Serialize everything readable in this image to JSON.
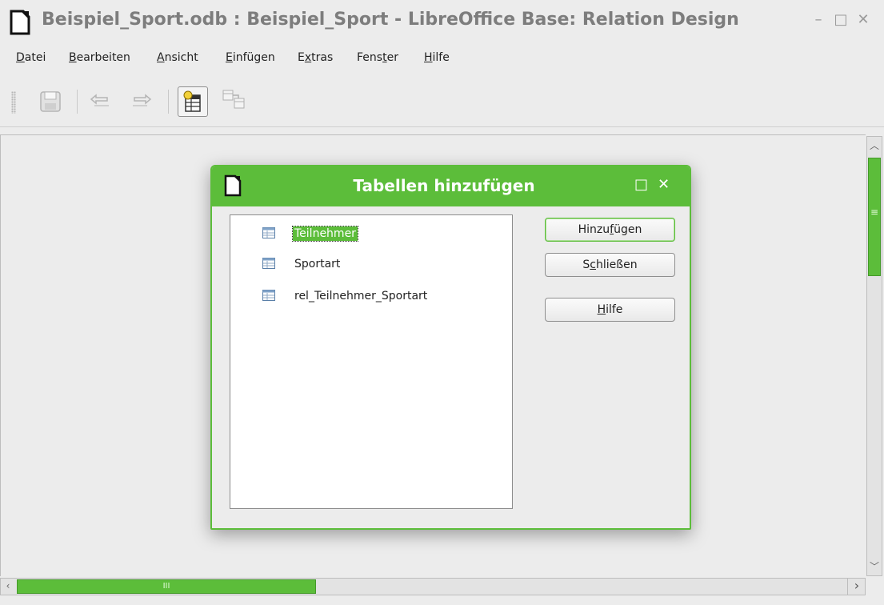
{
  "window": {
    "title": "Beispiel_Sport.odb : Beispiel_Sport - LibreOffice Base: Relation Design",
    "minimize": "–",
    "maximize": "□",
    "close": "✕"
  },
  "menubar": {
    "items": [
      {
        "mnemonic": "D",
        "rest": "atei"
      },
      {
        "mnemonic": "B",
        "rest": "earbeiten"
      },
      {
        "mnemonic": "A",
        "rest": "nsicht"
      },
      {
        "mnemonic": "E",
        "rest": "infügen"
      },
      {
        "pre": "E",
        "mnemonic": "x",
        "rest": "tras"
      },
      {
        "pre": "Fens",
        "mnemonic": "t",
        "rest": "er"
      },
      {
        "mnemonic": "H",
        "rest": "ilfe"
      }
    ]
  },
  "toolbar": {
    "icons": [
      "save-icon",
      "undo-icon",
      "redo-icon",
      "add-tables-icon",
      "new-relation-icon"
    ]
  },
  "dialog": {
    "title": "Tabellen hinzufügen",
    "maximize": "□",
    "close": "✕",
    "tables": [
      {
        "name": "Teilnehmer",
        "selected": true
      },
      {
        "name": "Sportart",
        "selected": false
      },
      {
        "name": "rel_Teilnehmer_Sportart",
        "selected": false
      }
    ],
    "buttons": {
      "add": {
        "pre": "Hinzu",
        "mnemonic": "f",
        "rest": "ügen"
      },
      "close": {
        "pre": "S",
        "mnemonic": "c",
        "rest": "hließen"
      },
      "help": {
        "pre": "",
        "mnemonic": "H",
        "rest": "ilfe"
      }
    }
  },
  "scrollbars": {
    "horizontal_grip": "III",
    "vertical_grip": "≡"
  },
  "colors": {
    "accent": "#5cbd3a",
    "title_text": "#7d7d7d"
  }
}
